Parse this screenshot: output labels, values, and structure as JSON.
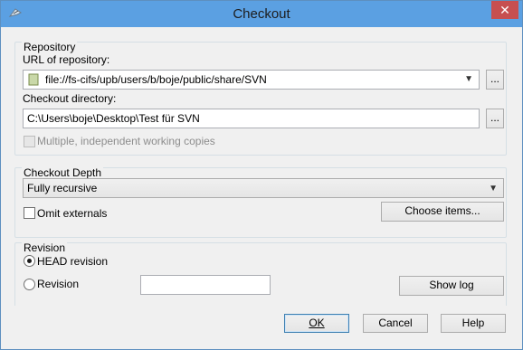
{
  "window": {
    "title": "Checkout",
    "close_glyph": "✕"
  },
  "repository": {
    "group_label": "Repository",
    "url_label": "URL of repository:",
    "url_value": "file://fs-cifs/upb/users/b/boje/public/share/SVN",
    "checkout_dir_label": "Checkout directory:",
    "checkout_dir_value": "C:\\Users\\boje\\Desktop\\Test für SVN",
    "browse_label": "...",
    "multiple_copies_label": "Multiple, independent working copies",
    "multiple_copies_checked": false
  },
  "depth": {
    "group_label": "Checkout Depth",
    "selected": "Fully recursive",
    "omit_externals_label": "Omit externals",
    "omit_externals_checked": false,
    "choose_items_label": "Choose items..."
  },
  "revision": {
    "group_label": "Revision",
    "head_label": "HEAD revision",
    "revision_label": "Revision",
    "selected": "HEAD revision",
    "revision_value": "",
    "show_log_label": "Show log"
  },
  "buttons": {
    "ok": "OK",
    "cancel": "Cancel",
    "help": "Help"
  },
  "icons": {
    "app": "tortoise-icon",
    "folder": "folder-icon"
  }
}
